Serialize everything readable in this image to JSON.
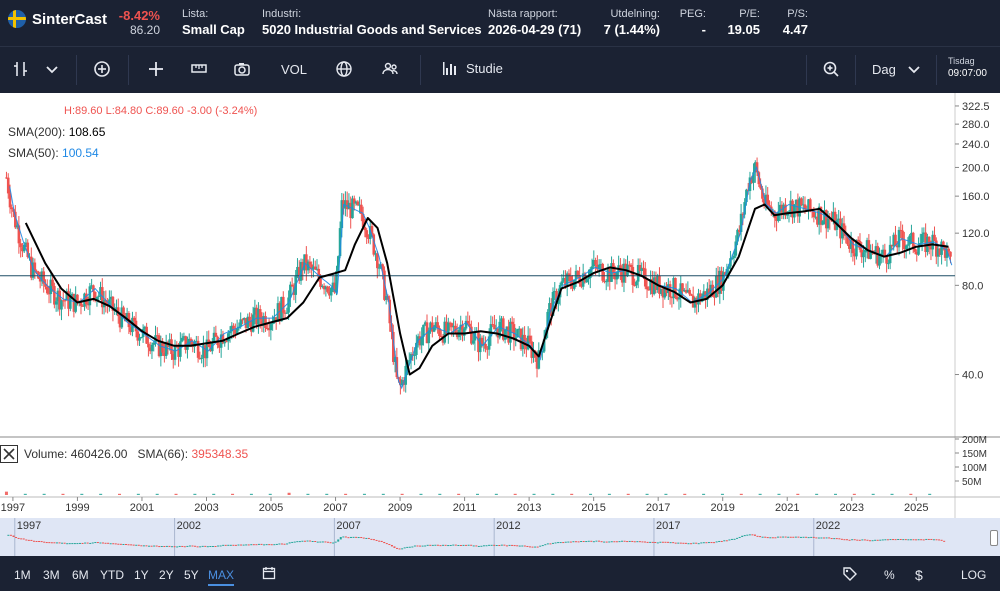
{
  "header": {
    "app_name": "SinterCast",
    "change_pct": "-8.42%",
    "price": "86.20",
    "stats": [
      {
        "label": "Lista:",
        "value": "Small Cap"
      },
      {
        "label": "Industri:",
        "value": "5020 Industrial Goods and Services"
      },
      {
        "label": "Nästa rapport:",
        "value": "2026-04-29 (71)"
      },
      {
        "label": "Utdelning:",
        "value": "7 (1.44%)"
      },
      {
        "label": "PEG:",
        "value": "-"
      },
      {
        "label": "P/E:",
        "value": "19.05"
      },
      {
        "label": "P/S:",
        "value": "4.47"
      }
    ]
  },
  "toolbar": {
    "vol_label": "VOL",
    "studie_label": "Studie",
    "interval_label": "Dag",
    "day_label": "Tisdag",
    "time_label": "09:07:00"
  },
  "legend": {
    "ohlc": {
      "h": "H:89.60",
      "l": "L:84.80",
      "c": "C:89.60",
      "chg": "-3.00 (-3.24%)"
    },
    "sma200": {
      "label": "SMA(200):",
      "value": "108.65"
    },
    "sma50": {
      "label": "SMA(50):",
      "value": "100.54"
    },
    "volume": {
      "label": "Volume:",
      "value": "460426.00",
      "sma_label": "SMA(66):",
      "sma_value": "395348.35"
    }
  },
  "colors": {
    "up": "#26a69a",
    "down": "#ef5350",
    "sma200": "#000000",
    "sma50": "#1e88e5",
    "accent": "#4a8fe0"
  },
  "chart_data": {
    "type": "candlestick",
    "scale": "log",
    "y_ticks": [
      322.5,
      280.0,
      240.0,
      200.0,
      160.0,
      120.0,
      80.0,
      40.0
    ],
    "volume_ticks": [
      "200M",
      "150M",
      "100M",
      "50M"
    ],
    "x_ticks": [
      "1997",
      "1999",
      "2001",
      "2003",
      "2005",
      "2007",
      "2009",
      "2011",
      "2013",
      "2015",
      "2017",
      "2019",
      "2021",
      "2023",
      "2025"
    ],
    "navigator_ticks": [
      "1997",
      "2002",
      "2007",
      "2012",
      "2017",
      "2022"
    ],
    "reference_line": 86.2,
    "price_series": {
      "x": [
        1996.8,
        1997.0,
        1997.3,
        1997.6,
        1998.0,
        1998.5,
        1999.0,
        1999.5,
        2000.0,
        2000.5,
        2001.0,
        2001.5,
        2002.0,
        2002.5,
        2003.0,
        2003.5,
        2004.0,
        2004.5,
        2005.0,
        2005.5,
        2006.0,
        2006.5,
        2006.8,
        2007.0,
        2007.2,
        2007.5,
        2007.8,
        2008.0,
        2008.3,
        2008.6,
        2008.9,
        2009.0,
        2009.2,
        2009.5,
        2010.0,
        2010.5,
        2011.0,
        2011.5,
        2012.0,
        2012.5,
        2013.0,
        2013.3,
        2013.6,
        2014.0,
        2014.5,
        2015.0,
        2015.5,
        2016.0,
        2016.5,
        2017.0,
        2017.5,
        2018.0,
        2018.5,
        2019.0,
        2019.5,
        2019.8,
        2020.0,
        2020.3,
        2020.6,
        2021.0,
        2021.5,
        2022.0,
        2022.5,
        2023.0,
        2023.5,
        2024.0,
        2024.5,
        2025.0,
        2025.5,
        2025.9,
        2026.1
      ],
      "y": [
        185,
        140,
        110,
        90,
        80,
        72,
        70,
        78,
        68,
        60,
        55,
        50,
        48,
        52,
        48,
        55,
        58,
        62,
        62,
        70,
        95,
        85,
        80,
        75,
        150,
        145,
        140,
        125,
        100,
        70,
        38,
        36,
        42,
        52,
        58,
        55,
        60,
        50,
        58,
        55,
        50,
        45,
        65,
        80,
        85,
        92,
        88,
        90,
        85,
        80,
        78,
        70,
        75,
        85,
        120,
        180,
        200,
        150,
        140,
        150,
        145,
        140,
        130,
        110,
        105,
        100,
        115,
        110,
        112,
        105,
        90
      ]
    },
    "sma200_series": {
      "x": [
        1997.4,
        1998.0,
        1998.5,
        1999.0,
        1999.5,
        2000.0,
        2000.5,
        2001.0,
        2001.5,
        2002.0,
        2002.5,
        2003.0,
        2003.5,
        2004.0,
        2004.5,
        2005.0,
        2005.5,
        2006.0,
        2006.5,
        2007.0,
        2007.3,
        2007.6,
        2008.0,
        2008.3,
        2008.6,
        2009.0,
        2009.3,
        2009.6,
        2010.0,
        2010.5,
        2011.0,
        2011.5,
        2012.0,
        2012.5,
        2013.0,
        2013.3,
        2013.6,
        2014.0,
        2014.5,
        2015.0,
        2015.5,
        2016.0,
        2016.5,
        2017.0,
        2017.5,
        2018.0,
        2018.5,
        2019.0,
        2019.5,
        2020.0,
        2020.3,
        2020.6,
        2021.0,
        2021.5,
        2022.0,
        2022.5,
        2023.0,
        2023.5,
        2024.0,
        2024.5,
        2025.0,
        2025.5,
        2026.0
      ],
      "y": [
        130,
        95,
        78,
        70,
        72,
        68,
        62,
        56,
        52,
        50,
        50,
        51,
        52,
        55,
        58,
        60,
        62,
        70,
        85,
        88,
        90,
        110,
        135,
        125,
        95,
        55,
        40,
        42,
        50,
        55,
        55,
        56,
        55,
        53,
        50,
        46,
        58,
        78,
        82,
        88,
        92,
        90,
        86,
        80,
        76,
        70,
        72,
        80,
        100,
        145,
        150,
        138,
        140,
        142,
        145,
        130,
        115,
        105,
        100,
        103,
        108,
        110,
        108
      ]
    },
    "volume_series": {
      "max": 200000000,
      "values": [
        12000000,
        3000000,
        2000000,
        1500000,
        1500000,
        1800000,
        1200000,
        1000000,
        1000000,
        1000000,
        800000,
        800000,
        800000,
        900000,
        1100000,
        8000000,
        3000000,
        4000000,
        1500000,
        1200000,
        2000000,
        1000000,
        1000000,
        900000,
        1500000,
        1100000,
        1000000,
        900000,
        800000,
        900000,
        1500000,
        1400000,
        900000,
        800000,
        1000000,
        800000,
        700000,
        800000,
        900000,
        800000,
        700000,
        700000,
        700000,
        700000,
        800000,
        800000,
        700000,
        700000,
        700000,
        500000
      ]
    }
  },
  "ranges": [
    "1M",
    "3M",
    "6M",
    "YTD",
    "1Y",
    "2Y",
    "5Y",
    "MAX"
  ],
  "active_range": "MAX",
  "bottom_right": {
    "pct": "%",
    "dollar": "$",
    "log": "LOG"
  }
}
